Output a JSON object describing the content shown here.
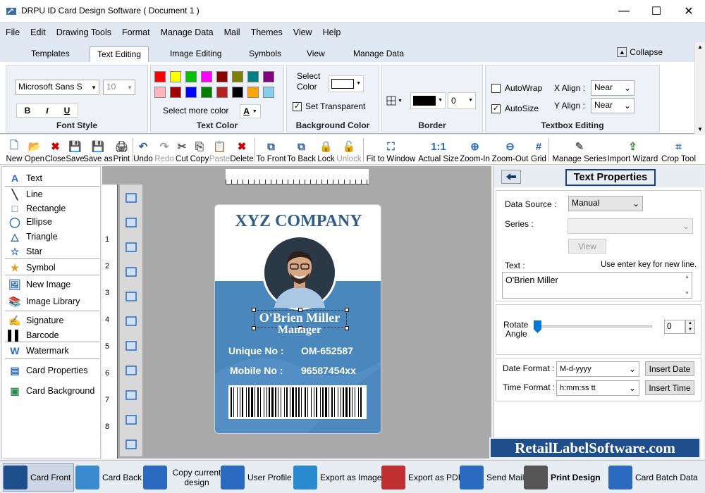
{
  "window": {
    "title": "DRPU ID Card Design Software ( Document 1 )"
  },
  "menu": [
    "File",
    "Edit",
    "Drawing Tools",
    "Format",
    "Manage Data",
    "Mail",
    "Themes",
    "View",
    "Help"
  ],
  "ribbon_tabs": [
    "Templates",
    "Text Editing",
    "Image Editing",
    "Symbols",
    "View",
    "Manage Data"
  ],
  "active_tab": "Text Editing",
  "collapse_label": "Collapse",
  "font_style": {
    "font": "Microsoft Sans S",
    "size": "10",
    "bold": "B",
    "italic": "I",
    "underline": "U",
    "label": "Font Style"
  },
  "text_color": {
    "label": "Text Color",
    "select_more": "Select more color",
    "glyph": "A",
    "swatches_row1": [
      "#ff0000",
      "#ffff00",
      "#00c000",
      "#ff00ff",
      "#8b0000",
      "#808000",
      "#008080",
      "#800080"
    ],
    "swatches_row2": [
      "#ffb6c1",
      "#a00000",
      "#0000ff",
      "#008000",
      "#b22222",
      "#000000",
      "#ffa500",
      "#87ceeb"
    ]
  },
  "background_color": {
    "label": "Background Color",
    "select_color_1": "Select",
    "select_color_2": "Color",
    "transparent": "Set Transparent"
  },
  "border": {
    "label": "Border",
    "width": "0"
  },
  "textbox_editing": {
    "label": "Textbox Editing",
    "autowrap": "AutoWrap",
    "autosize": "AutoSize",
    "x_align_label": "X Align :",
    "x_align": "Near",
    "y_align_label": "Y Align :",
    "y_align": "Near"
  },
  "toolbar": [
    "New",
    "Open",
    "Close",
    "Save",
    "Save as",
    "Print",
    "Undo",
    "Redo",
    "Cut",
    "Copy",
    "Paste",
    "Delete",
    "To Front",
    "To Back",
    "Lock",
    "Unlock",
    "Fit to Window",
    "Actual Size",
    "Zoom-In",
    "Zoom-Out",
    "Grid",
    "Manage Series",
    "Import Wizard",
    "Crop Tool"
  ],
  "left_tools": [
    "Text",
    "Line",
    "Rectangle",
    "Ellipse",
    "Triangle",
    "Star",
    "Symbol",
    "New Image",
    "Image Library",
    "Signature",
    "Barcode",
    "Watermark",
    "Card Properties",
    "Card Background"
  ],
  "ruler": {
    "v_marks": [
      "1",
      "2",
      "3",
      "4",
      "5",
      "6",
      "7",
      "8"
    ]
  },
  "card": {
    "company": "XYZ COMPANY",
    "name": "O'Brien Miller",
    "role": "Manager",
    "unique_label": "Unique No :",
    "unique_value": "OM-652587",
    "mobile_label": "Mobile No :",
    "mobile_value": "96587454xx",
    "colors": {
      "header": "#2f5d8a",
      "body": "#4a87bd"
    }
  },
  "text_properties": {
    "title": "Text Properties",
    "data_source_label": "Data Source :",
    "data_source": "Manual",
    "series_label": "Series :",
    "view_btn": "View",
    "text_label": "Text :",
    "text_hint": "Use enter key for new line.",
    "text_value": "O'Brien Miller",
    "rotate_1": "Rotate",
    "rotate_2": "Angle",
    "rotate_value": "0",
    "date_format_label": "Date Format :",
    "date_format": "M-d-yyyy",
    "insert_date": "Insert Date",
    "time_format_label": "Time Format :",
    "time_format": "h:mm:ss tt",
    "insert_time": "Insert Time"
  },
  "brand_banner": "RetailLabelSoftware.com",
  "bottom": [
    "Card Front",
    "Card Back",
    "Copy current design",
    "User Profile",
    "Export as Image",
    "Export as PDF",
    "Send Mail",
    "Print Design",
    "Card Batch Data"
  ]
}
